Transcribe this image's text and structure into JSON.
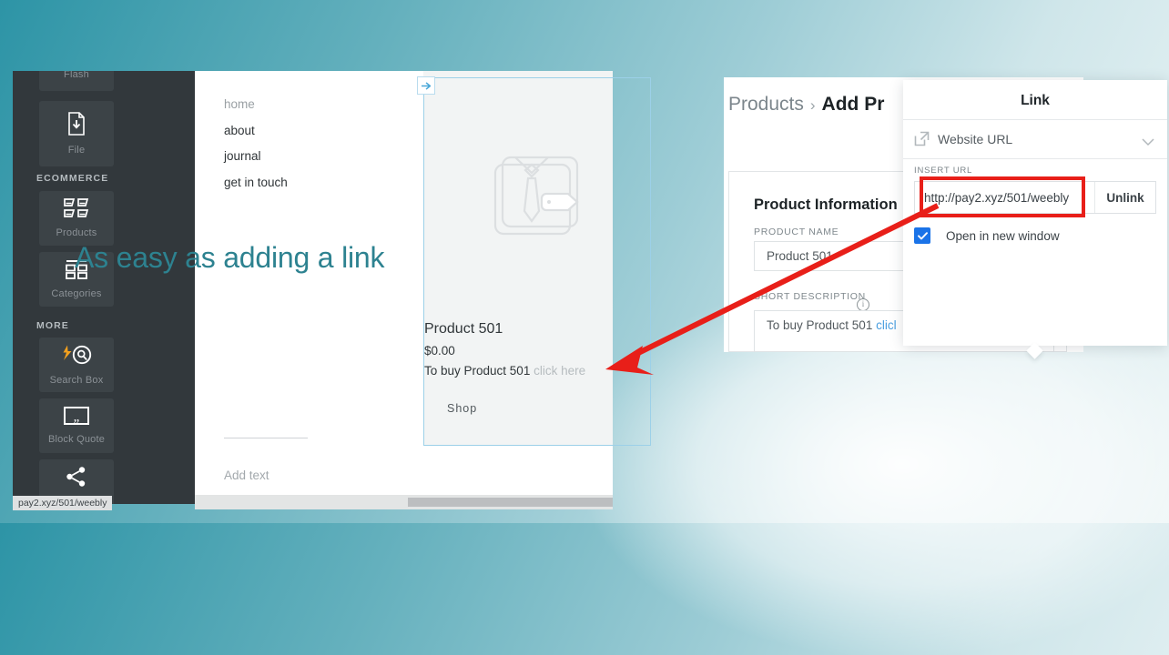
{
  "sidebar": {
    "tiles": [
      {
        "label": "Flash",
        "icon": "flash-icon"
      },
      {
        "label": "File",
        "icon": "file-download-icon"
      },
      {
        "label": "Products",
        "icon": "products-grid-icon"
      },
      {
        "label": "Categories",
        "icon": "categories-grid-icon"
      },
      {
        "label": "Search Box",
        "icon": "search-box-icon"
      },
      {
        "label": "Block Quote",
        "icon": "block-quote-icon"
      },
      {
        "label": "Share",
        "icon": "share-icon"
      }
    ],
    "headings": {
      "ecommerce": "ECOMMERCE",
      "more": "MORE"
    }
  },
  "canvas": {
    "nav": [
      {
        "label": "home"
      },
      {
        "label": "about"
      },
      {
        "label": "journal"
      },
      {
        "label": "get in touch"
      }
    ],
    "headline": "As easy as adding a link",
    "add_text": "Add text",
    "product": {
      "name": "Product 501",
      "price": "$0.00",
      "description_prefix": "To buy Product 501 ",
      "description_link": "click here",
      "shop_button": "Shop"
    }
  },
  "admin": {
    "breadcrumb": {
      "parent": "Products",
      "separator": "›",
      "current": "Add Pr"
    },
    "card": {
      "title": "Product Information",
      "product_name_label": "PRODUCT NAME",
      "product_name_value": "Product 501",
      "short_description_label": "SHORT DESCRIPTION",
      "short_description_prefix": "To buy Product 501 ",
      "short_description_link": "clicl"
    }
  },
  "link_panel": {
    "title": "Link",
    "type_label": "Website URL",
    "type_icon": "external-link-icon",
    "chevron_icon": "chevron-down-icon",
    "insert_url_label": "INSERT URL",
    "url_value": "http://pay2.xyz/501/weebly",
    "url_placeholder": "http://",
    "unlink_label": "Unlink",
    "open_new_window_label": "Open in new window",
    "open_new_window_checked": true,
    "highlight_color": "#e81f19",
    "checkbox_color": "#1a73e8"
  },
  "status_bar": {
    "url": "pay2.xyz/501/weebly"
  },
  "theme": {
    "accent_teal": "#2d8290",
    "sidebar_bg": "#32383c",
    "link_blue": "#4a9fe0",
    "annotation_red": "#e81f19"
  }
}
